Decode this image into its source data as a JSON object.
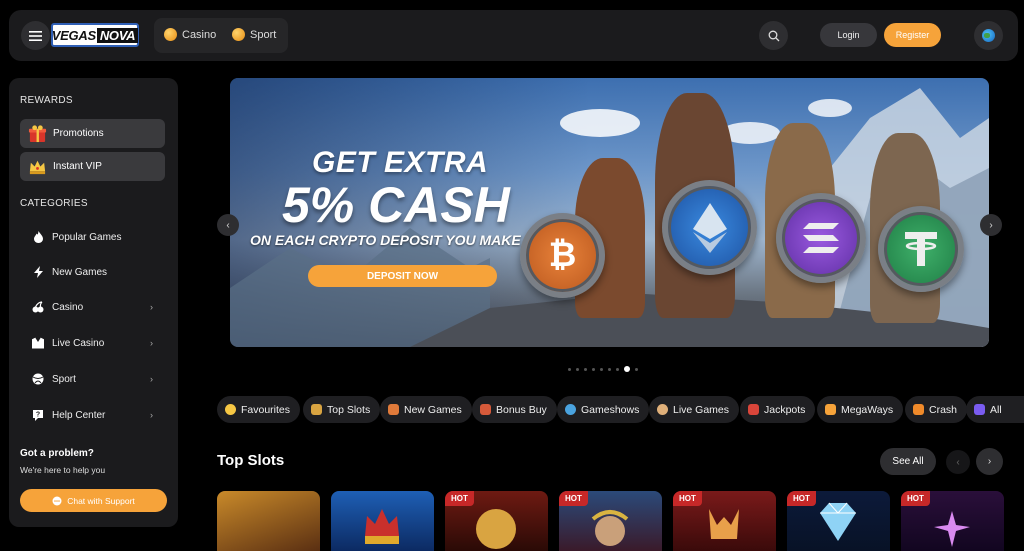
{
  "header": {
    "logo_text_a": "VEGAS",
    "logo_text_b": "NOVA",
    "nav": [
      {
        "label": "Casino",
        "icon": "casino-coin-icon"
      },
      {
        "label": "Sport",
        "icon": "sport-coin-icon"
      }
    ],
    "login_label": "Login",
    "register_label": "Register"
  },
  "sidebar": {
    "rewards_title": "REWARDS",
    "rewards": [
      {
        "label": "Promotions",
        "icon": "gift-icon"
      },
      {
        "label": "Instant VIP",
        "icon": "crown-icon"
      }
    ],
    "categories_title": "CATEGORIES",
    "categories": [
      {
        "label": "Popular Games",
        "icon": "fire-icon",
        "chevron": false
      },
      {
        "label": "New Games",
        "icon": "lightning-icon",
        "chevron": false
      },
      {
        "label": "Casino",
        "icon": "cherry-icon",
        "chevron": true
      },
      {
        "label": "Live Casino",
        "icon": "suit-icon",
        "chevron": true
      },
      {
        "label": "Sport",
        "icon": "ball-icon",
        "chevron": true
      },
      {
        "label": "Help Center",
        "icon": "help-icon",
        "chevron": true
      }
    ],
    "help_title": "Got a problem?",
    "help_subtitle": "We're here to help you",
    "support_label": "Chat with Support"
  },
  "banner": {
    "line1": "GET EXTRA",
    "line2": "5% CASH",
    "line3": "ON EACH CRYPTO DEPOSIT YOU MAKE",
    "cta_label": "DEPOSIT NOW",
    "slides_total": 9,
    "active_slide": 8
  },
  "chips": [
    {
      "label": "Favourites",
      "icon": "star-icon",
      "color": "#f6c744"
    },
    {
      "label": "Top Slots",
      "icon": "slot-icon",
      "color": "#d9a441"
    },
    {
      "label": "New Games",
      "icon": "new-games-icon",
      "color": "#e07a3a"
    },
    {
      "label": "Bonus Buy",
      "icon": "bonus-icon",
      "color": "#d65a3a"
    },
    {
      "label": "Gameshows",
      "icon": "wheel-icon",
      "color": "#4aa3df"
    },
    {
      "label": "Live Games",
      "icon": "dealer-icon",
      "color": "#e0b07a"
    },
    {
      "label": "Jackpots",
      "icon": "jackpot-icon",
      "color": "#d9453a"
    },
    {
      "label": "MegaWays",
      "icon": "megaways-icon",
      "color": "#f6a33a"
    },
    {
      "label": "Crash",
      "icon": "rocket-icon",
      "color": "#f08a2a"
    },
    {
      "label": "All",
      "icon": "all-icon",
      "color": "#7a5cf0"
    }
  ],
  "top_slots": {
    "title": "Top Slots",
    "see_all_label": "See All",
    "cards": [
      {
        "badge": "",
        "theme": "pharaoh"
      },
      {
        "badge": "",
        "theme": "crown"
      },
      {
        "badge": "HOT",
        "theme": "gold-lion"
      },
      {
        "badge": "HOT",
        "theme": "emperor"
      },
      {
        "badge": "HOT",
        "theme": "wolf"
      },
      {
        "badge": "HOT",
        "theme": "diamond"
      },
      {
        "badge": "HOT",
        "theme": "star"
      }
    ]
  },
  "colors": {
    "accent": "#f6a33a",
    "panel": "#1b1b1d",
    "hot": "#c62828"
  }
}
